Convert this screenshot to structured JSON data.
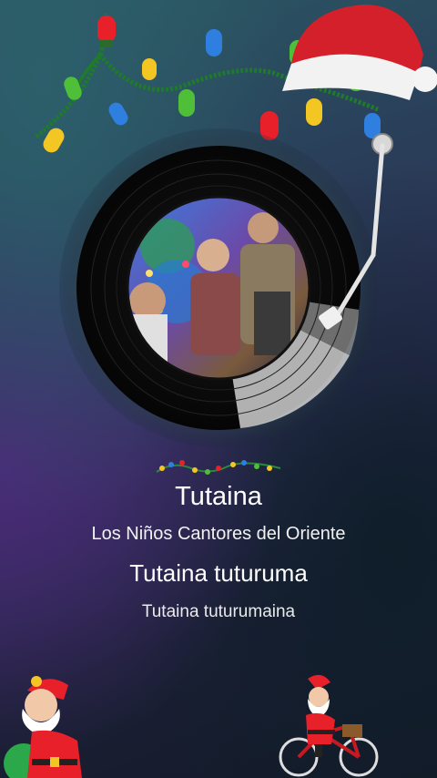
{
  "player": {
    "song_title": "Tutaina",
    "artist": "Los Niños Cantores del Oriente"
  },
  "lyrics": {
    "current": "Tutaina tuturuma",
    "next": "Tutaina tuturumaina"
  },
  "colors": {
    "vinyl": "#0c0c0c",
    "light_red": "#e8202a",
    "light_green": "#4fbf3a",
    "light_blue": "#2f7fe0",
    "light_yellow": "#f3c623",
    "wire": "#1f7a2c"
  },
  "icons": {
    "lights": "christmas-lights-icon",
    "hat": "santa-hat-icon",
    "record": "vinyl-record-icon",
    "tonearm": "tonearm-icon",
    "santa_left": "santa-gift-icon",
    "santa_bike": "santa-bicycle-icon"
  }
}
